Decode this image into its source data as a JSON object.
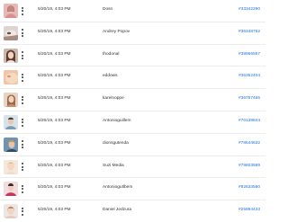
{
  "colors": {
    "link": "#1a73e8",
    "text": "#333333",
    "divider": "#ececec"
  },
  "rows": [
    {
      "date": "5/20/19, 4:03 PM",
      "author": "Dosn",
      "post_id": "#33342290",
      "thumb": "pink-portrait-photo"
    },
    {
      "date": "5/20/19, 4:03 PM",
      "author": "Andrey Popov",
      "post_id": "#36348752",
      "thumb": "beauty-makeup-photo"
    },
    {
      "date": "5/20/19, 4:03 PM",
      "author": "thodonal",
      "post_id": "#38966557",
      "thumb": "woman-portrait-photo"
    },
    {
      "date": "5/20/19, 4:03 PM",
      "author": "eddows",
      "post_id": "#36352404",
      "thumb": "skin-closeup-photo"
    },
    {
      "date": "5/20/19, 4:03 PM",
      "author": "karelnoppe",
      "post_id": "#36757465",
      "thumb": "woman-portrait-photo"
    },
    {
      "date": "5/20/19, 4:03 PM",
      "author": "Antonioguillem",
      "post_id": "#70138844",
      "thumb": "man-portrait-photo"
    },
    {
      "date": "5/20/19, 4:03 PM",
      "author": "dionsgutenda",
      "post_id": "#78544632",
      "thumb": "blue-portrait-photo"
    },
    {
      "date": "5/20/19, 4:03 PM",
      "author": "Suzi Media",
      "post_id": "#78803589",
      "thumb": "light-portrait-photo"
    },
    {
      "date": "5/20/19, 4:03 PM",
      "author": "Antoniogutlbem",
      "post_id": "#82633580",
      "thumb": "pink-portrait-photo"
    },
    {
      "date": "5/20/19, 4:03 PM",
      "author": "Daniel Jedzura",
      "post_id": "#25894433",
      "thumb": "light-portrait-photo"
    }
  ]
}
